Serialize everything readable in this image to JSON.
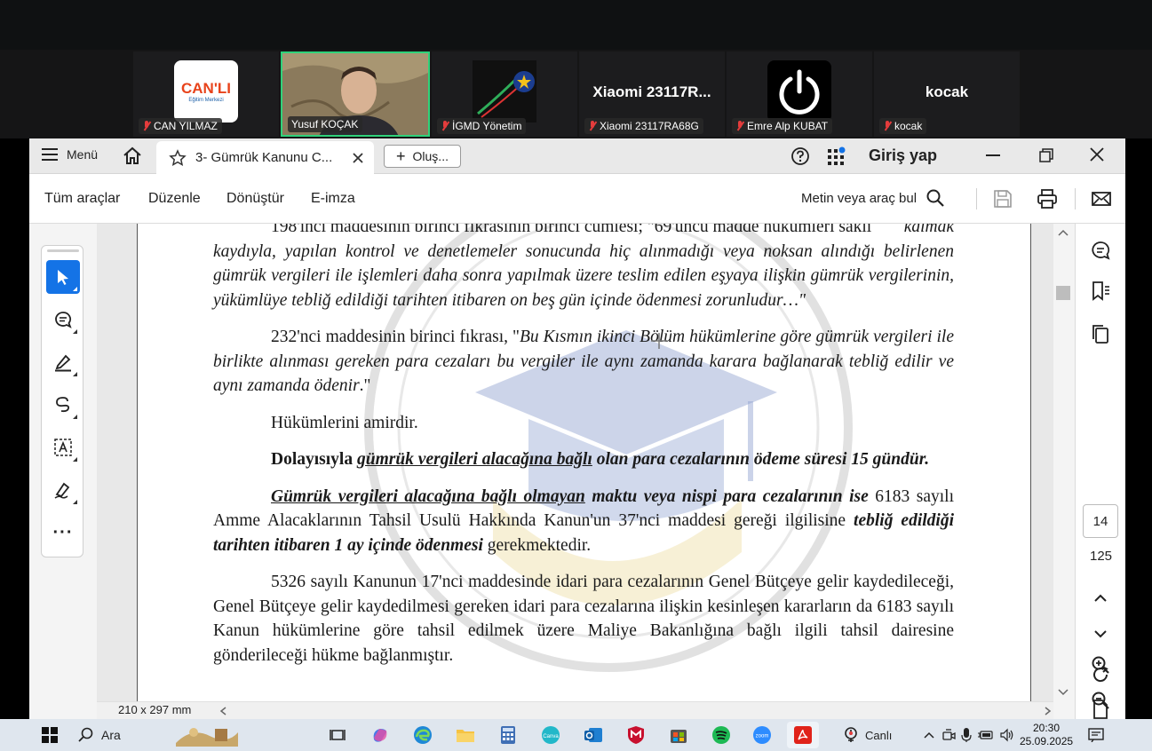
{
  "call": {
    "participants": [
      {
        "name": "CAN YILMAZ",
        "logo_text": "CAN'LI",
        "logo_sub": "Eğitim Merkezi"
      },
      {
        "name": "Yusuf KOÇAK"
      },
      {
        "name": "İGMD Yönetim"
      },
      {
        "name": "Xiaomi 23117RA68G",
        "big_text": "Xiaomi  23117R..."
      },
      {
        "name": "Emre Alp KUBAT"
      },
      {
        "name": "kocak",
        "big_text": "kocak"
      }
    ]
  },
  "app": {
    "menu_label": "Menü",
    "tab_title": "3- Gümrük Kanunu C...",
    "new_tab_label": "Oluş...",
    "sign_in": "Giriş yap",
    "menus": [
      "Tüm araçlar",
      "Düzenle",
      "Dönüştür",
      "E-imza"
    ],
    "search_placeholder": "Metin veya araç bul",
    "page_size": "210 x 297 mm",
    "current_page": "14",
    "total_pages": "125"
  },
  "document": {
    "p1_line0": "198'inci maddesinin birinci fıkrasının birinci cümlesi; \"69'uncu madde hükümleri saklı",
    "p1_rest": "kalmak kaydıyla, yapılan kontrol ve denetlemeler sonucunda hiç alınmadığı veya noksan alındığı belirlenen gümrük vergileri ile işlemleri daha sonra yapılmak üzere teslim edilen eşyaya ilişkin gümrük vergilerinin, yükümlüye tebliğ edildiği tarihten itibaren on beş gün içinde ödenmesi zorunludur…\"",
    "p2_start": "232'nci maddesinin birinci fıkrası, \"",
    "p2_italic": "Bu Kısmın ikinci Bölüm hükümlerine göre gümrük vergileri ile birlikte alınması gereken para cezaları bu vergiler ile aynı zamanda karara bağlanarak tebliğ edilir ve aynı zamanda ödenir",
    "p2_end": ".\"",
    "p3": "Hükümlerini amirdir.",
    "p4_a": "Dolayısıyla ",
    "p4_b": "gümrük vergileri alacağına bağlı",
    "p4_c": " olan para cezalarının ödeme süresi 15 gündür.",
    "p5_a": "Gümrük vergileri alacağına bağlı olmayan",
    "p5_b": " maktu veya nispi para cezalarının ise",
    "p5_c": " 6183 sayılı Amme Alacaklarının Tahsil Usulü Hakkında Kanun'un 37'nci maddesi gereği ilgilisine ",
    "p5_d": "tebliğ edildiği tarihten itibaren 1 ay içinde ödenmesi",
    "p5_e": " gerekmektedir.",
    "p6": "5326 sayılı Kanunun 17'nci maddesinde idari para cezalarının Genel Bütçeye gelir kaydedileceği, Genel Bütçeye gelir kaydedilmesi gereken idari para cezalarına ilişkin kesinleşen kararların da 6183 sayılı Kanun hükümlerine göre tahsil edilmek üzere Maliye Bakanlığına bağlı ilgili tahsil dairesine gönderileceği hükme bağlanmıştır."
  },
  "taskbar": {
    "search_label": "Ara",
    "canli_label": "Canlı",
    "time": "20:30",
    "date": "25.09.2025"
  }
}
